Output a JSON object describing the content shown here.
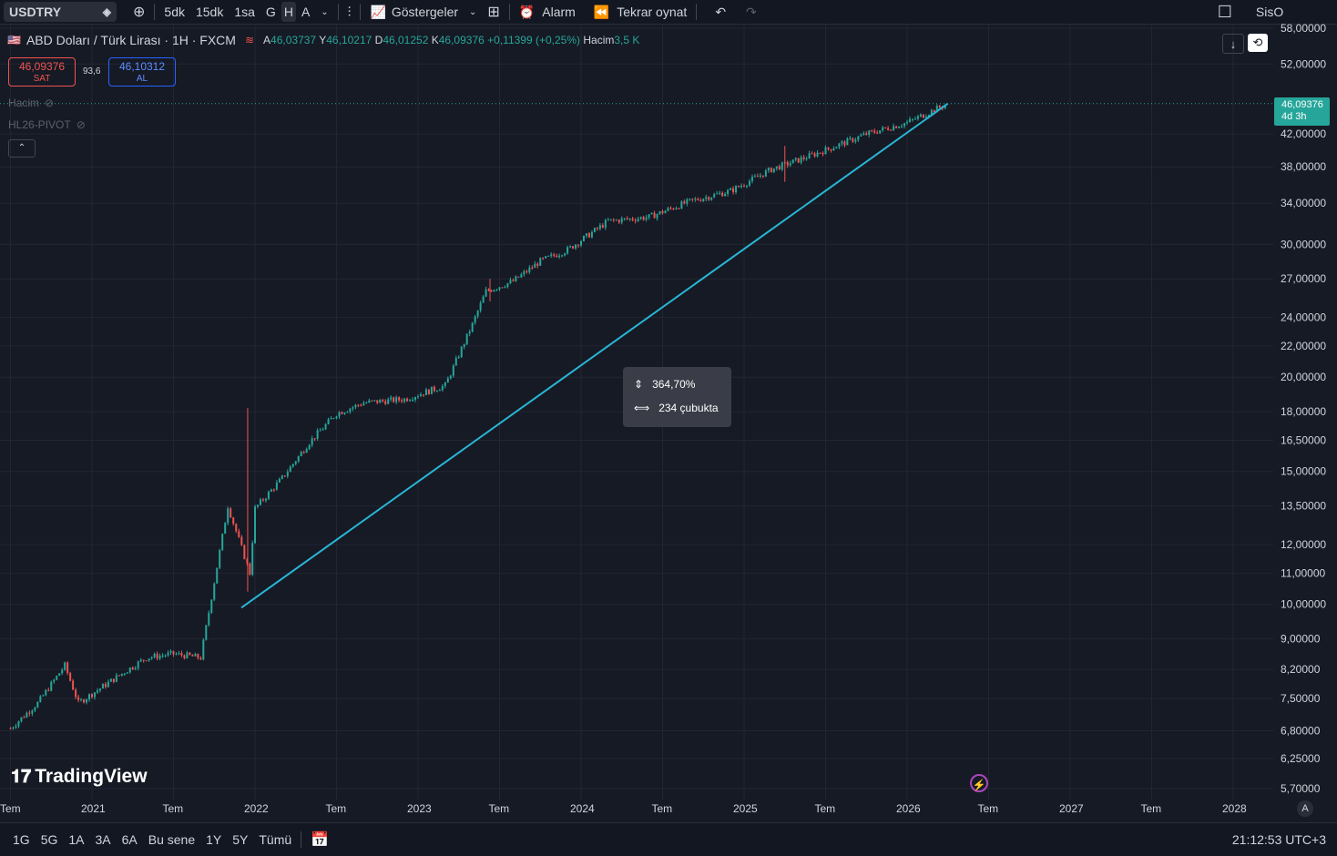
{
  "toolbar": {
    "symbol": "USDTRY",
    "intervals": [
      "5dk",
      "15dk",
      "1sa",
      "G",
      "H",
      "A"
    ],
    "active_interval": "H",
    "indicators_label": "Göstergeler",
    "alert_label": "Alarm",
    "replay_label": "Tekrar oynat",
    "right_label": "SisO"
  },
  "legend": {
    "title": "ABD Doları / Türk Lirası · 1H · FXCM",
    "open_label": "A",
    "open": "46,03737",
    "high_label": "Y",
    "high": "46,10217",
    "low_label": "D",
    "low": "46,01252",
    "close_label": "K",
    "close": "46,09376",
    "change": "+0,11399 (+0,25%)",
    "volume_label": "Hacim",
    "volume": "3,5 K"
  },
  "trade": {
    "sell_price": "46,09376",
    "sell_label": "SAT",
    "spread": "93,6",
    "buy_price": "46,10312",
    "buy_label": "AL"
  },
  "indicators": [
    "Hacim",
    "HL26-PIVOT"
  ],
  "tooltip": {
    "percent": "364,70%",
    "bars": "234 çubukta"
  },
  "price_badge": {
    "price": "46,09376",
    "countdown": "4d 3h"
  },
  "y_axis_ticks": [
    "58,00000",
    "52,00000",
    "42,00000",
    "38,00000",
    "34,00000",
    "30,00000",
    "27,00000",
    "24,00000",
    "22,00000",
    "20,00000",
    "18,00000",
    "16,50000",
    "15,00000",
    "13,50000",
    "12,00000",
    "11,00000",
    "10,00000",
    "9,00000",
    "8,20000",
    "7,50000",
    "6,80000",
    "6,25000",
    "5,70000"
  ],
  "x_axis_ticks": [
    "Tem",
    "2021",
    "Tem",
    "2022",
    "Tem",
    "2023",
    "Tem",
    "2024",
    "Tem",
    "2025",
    "Tem",
    "2026",
    "Tem",
    "2027",
    "Tem",
    "2028"
  ],
  "axis_mode": "A",
  "bottom": {
    "ranges": [
      "1G",
      "5G",
      "1A",
      "3A",
      "6A",
      "Bu sene",
      "1Y",
      "5Y",
      "Tümü"
    ],
    "clock": "21:12:53 UTC+3"
  },
  "brand": "TradingView",
  "colors": {
    "up": "#26a69a",
    "down": "#ef5350",
    "trendline": "#29b6d6",
    "background": "#161a25"
  },
  "chart_data": {
    "type": "line",
    "scale": "log",
    "ylim": [
      5.7,
      58
    ],
    "series": [
      {
        "name": "USDTRY",
        "x": [
          "2020-07",
          "2020-09",
          "2020-11",
          "2020-12",
          "2021-03",
          "2021-05",
          "2021-07",
          "2021-09",
          "2021-11",
          "2021-12-20",
          "2022-01",
          "2022-03",
          "2022-05",
          "2022-07",
          "2022-09",
          "2022-12",
          "2023-03",
          "2023-05",
          "2023-06",
          "2023-08",
          "2023-10",
          "2023-12",
          "2024-03",
          "2024-06",
          "2024-09",
          "2024-12",
          "2025-03",
          "2025-05",
          "2025-07",
          "2025-10",
          "2026-01",
          "2026-04"
        ],
        "values": [
          6.85,
          7.4,
          8.3,
          7.4,
          8.05,
          8.5,
          8.6,
          8.5,
          13.5,
          11.0,
          13.4,
          14.7,
          16.4,
          17.9,
          18.5,
          18.7,
          19.5,
          23.5,
          26.0,
          26.8,
          28.5,
          29.5,
          32.2,
          32.6,
          34.2,
          35.3,
          37.7,
          38.8,
          40.0,
          42.0,
          43.5,
          46.09
        ]
      }
    ],
    "trendline": {
      "start": [
        "2021-12",
        9.9
      ],
      "end": [
        "2026-04",
        46.09
      ]
    },
    "measure": {
      "percent": "364,70%",
      "bars": "234 çubukta"
    }
  }
}
